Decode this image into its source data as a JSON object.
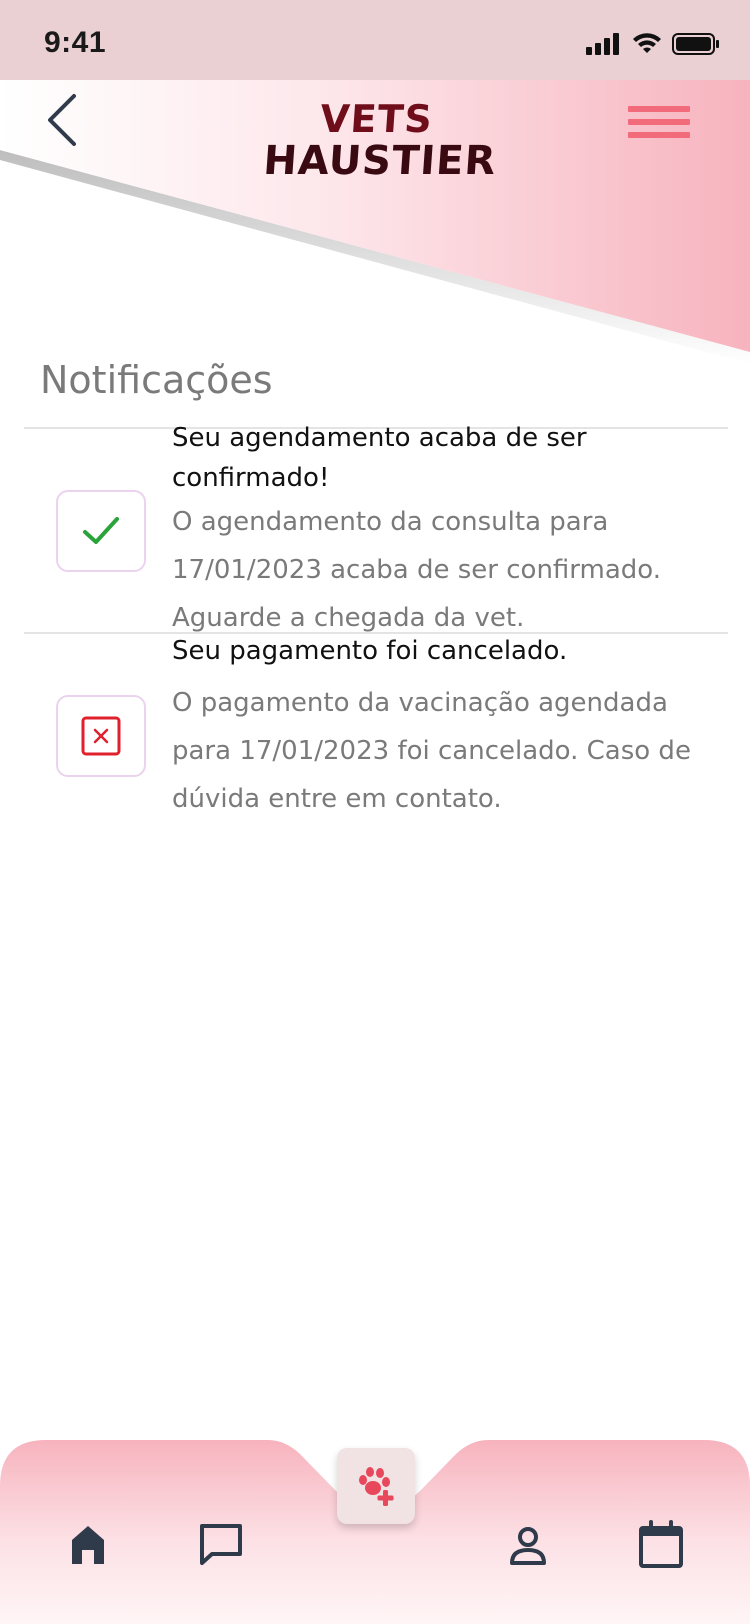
{
  "status_bar": {
    "time": "9:41"
  },
  "header": {
    "logo_line1": "VETS",
    "logo_line2": "HAUSTIER"
  },
  "page": {
    "title": "Notificações"
  },
  "notifications": [
    {
      "status": "confirmed",
      "icon": "check-icon",
      "title": "Seu agendamento acaba de ser confirmado!",
      "body": "O agendamento da consulta  para 17/01/2023 acaba de ser confirmado. Aguarde a chegada da vet."
    },
    {
      "status": "cancelled",
      "icon": "close-square-icon",
      "title": "Seu pagamento foi cancelado.",
      "body": "O pagamento da vacinação agendada para 17/01/2023 foi cancelado. Caso de dúvida entre em contato."
    }
  ],
  "nav": {
    "items": [
      "home-icon",
      "chat-icon",
      "paw-add-icon",
      "profile-icon",
      "calendar-icon"
    ]
  },
  "colors": {
    "accent": "#f26b7b",
    "success": "#2aa33a",
    "danger": "#e0202c",
    "header_gradient_end": "#f7b3be"
  }
}
